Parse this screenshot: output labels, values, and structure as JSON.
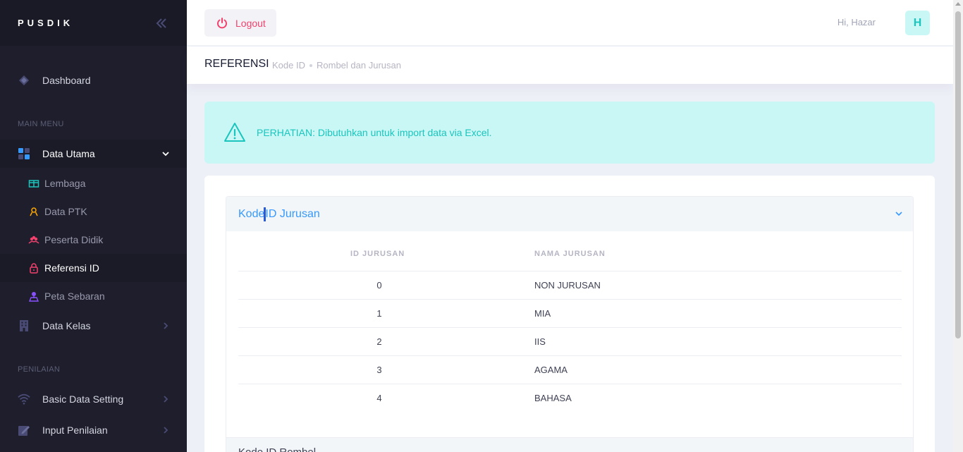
{
  "brand": {
    "logo": "PUSDIK"
  },
  "sidebar": {
    "dashboard": "Dashboard",
    "section_main": "MAIN MENU",
    "data_utama": "Data Utama",
    "sub": {
      "lembaga": "Lembaga",
      "data_ptk": "Data PTK",
      "peserta_didik": "Peserta Didik",
      "referensi_id": "Referensi ID",
      "peta_sebaran": "Peta Sebaran"
    },
    "data_kelas": "Data Kelas",
    "section_penilaian": "PENILAIAN",
    "basic_data_setting": "Basic Data Setting",
    "input_penilaian": "Input Penilaian"
  },
  "header": {
    "logout_label": "Logout",
    "greeting": "Hi, Hazar",
    "avatar_initial": "H"
  },
  "subheader": {
    "title": "REFERENSI",
    "breadcrumbs": [
      "Kode ID",
      "Rombel dan Jurusan"
    ]
  },
  "alert": {
    "text": "PERHATIAN: Dibutuhkan untuk import data via Excel."
  },
  "accordion": {
    "title_part1": "Kode",
    "title_part2": "ID Jurusan",
    "columns": [
      "ID JURUSAN",
      "NAMA JURUSAN"
    ],
    "rows": [
      {
        "id": "0",
        "name": "NON JURUSAN"
      },
      {
        "id": "1",
        "name": "MIA"
      },
      {
        "id": "2",
        "name": "IIS"
      },
      {
        "id": "3",
        "name": "AGAMA"
      },
      {
        "id": "4",
        "name": "BAHASA"
      }
    ],
    "next_title": "Kode ID Rombel"
  },
  "colors": {
    "sidebar_bg": "#1e1e2d",
    "accent_blue": "#3699ff",
    "danger": "#f1416c",
    "info": "#1bc5bd",
    "info_light": "#c9f7f5"
  }
}
